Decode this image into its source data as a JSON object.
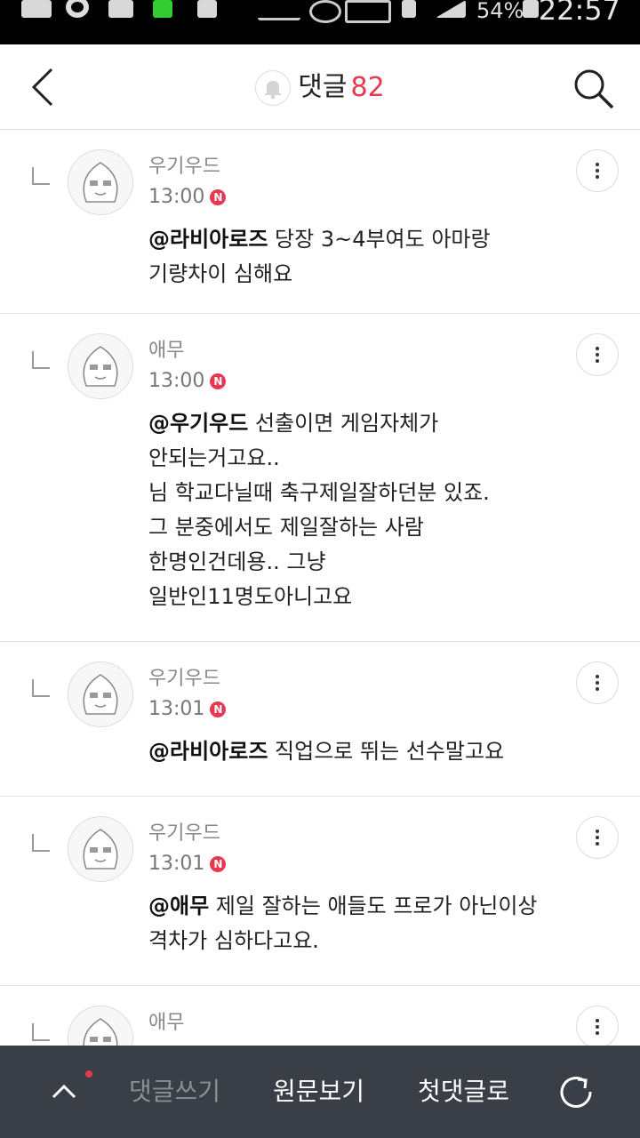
{
  "status_bar": {
    "battery": "54%",
    "time": "22:57"
  },
  "header": {
    "title": "댓글",
    "count": "82"
  },
  "comments": [
    {
      "author": "우기우드",
      "time": "13:00",
      "badge": "N",
      "mention": "@라비아로즈",
      "lines": [
        " 당장 3~4부여도 아마랑",
        "기량차이 심해요"
      ]
    },
    {
      "author": "애무",
      "time": "13:00",
      "badge": "N",
      "mention": "@우기우드",
      "lines": [
        " 선출이면 게임자체가",
        "안되는거고요..",
        "님 학교다닐때 축구제일잘하던분 있죠.",
        "그 분중에서도 제일잘하는 사람",
        "한명인건데용.. 그냥",
        "일반인11명도아니고요"
      ]
    },
    {
      "author": "우기우드",
      "time": "13:01",
      "badge": "N",
      "mention": "@라비아로즈",
      "lines": [
        " 직업으로 뛰는 선수말고요"
      ]
    },
    {
      "author": "우기우드",
      "time": "13:01",
      "badge": "N",
      "mention": "@애무",
      "lines": [
        " 제일 잘하는 애들도 프로가 아닌이상",
        "격차가 심하다고요."
      ]
    },
    {
      "author": "애무"
    }
  ],
  "bottom_bar": {
    "write": "댓글쓰기",
    "original": "원문보기",
    "first": "첫댓글로"
  },
  "colors": {
    "accent": "#e8384f",
    "bottom_bg": "#3a3f47"
  }
}
